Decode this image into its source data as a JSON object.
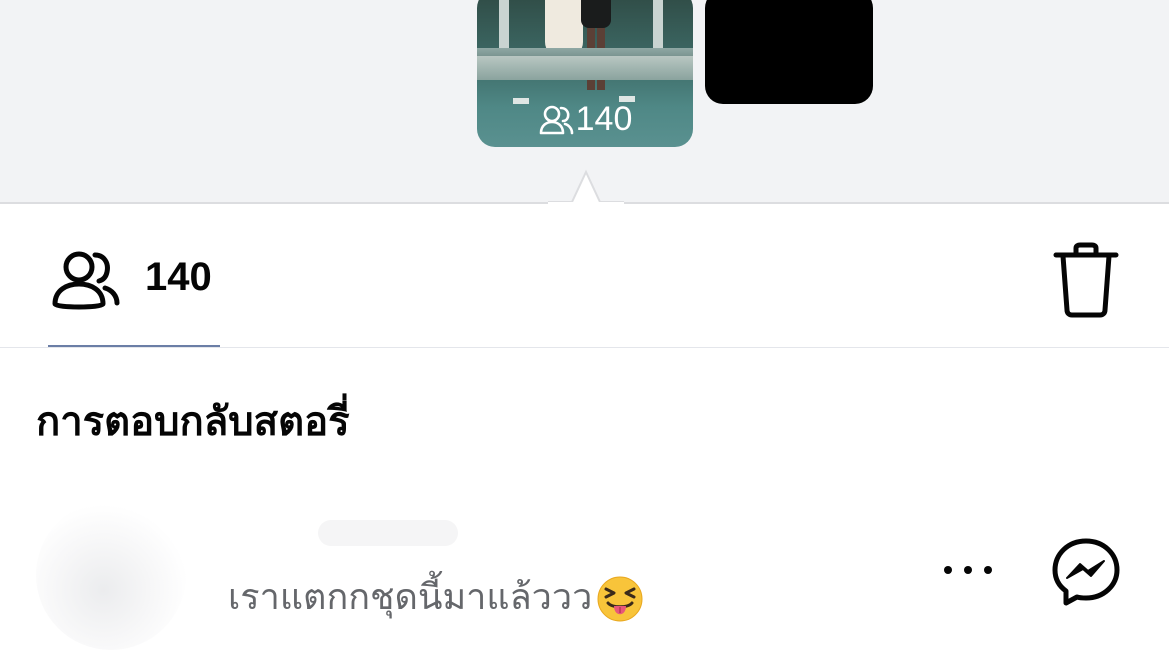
{
  "stories": {
    "thumbnail": {
      "viewer_count": "140",
      "viewer_icon": "viewers-icon"
    },
    "next_card_color": "#000000"
  },
  "viewers": {
    "count": "140",
    "icon": "viewers-icon",
    "delete_icon": "trash-icon"
  },
  "replies": {
    "section_title": "การตอบกลับสตอรี่",
    "items": [
      {
        "message": "เราแตกกชุดนี้มาแล้ววว",
        "emoji": "squinting-face-with-tongue",
        "more_icon": "more-icon",
        "messenger_icon": "messenger-icon"
      }
    ]
  },
  "colors": {
    "background_top": "#f2f3f5",
    "tab_underline": "#6b7ea6",
    "secondary_text": "#65676b"
  }
}
